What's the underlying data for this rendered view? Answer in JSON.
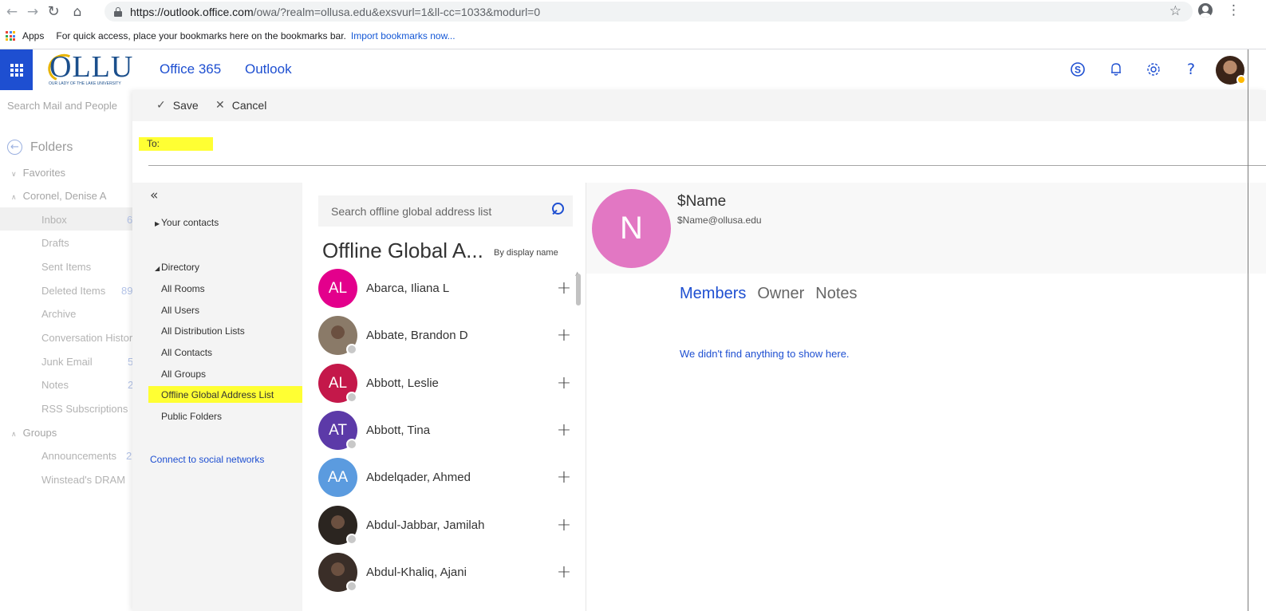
{
  "browser": {
    "url_host": "https://outlook.office.com",
    "url_path": "/owa/?realm=ollusa.edu&exsvurl=1&ll-cc=1033&modurl=0",
    "bookmarks_apps": "Apps",
    "bookmarks_hint": "For quick access, place your bookmarks here on the bookmarks bar.",
    "bookmarks_import": "Import bookmarks now..."
  },
  "header": {
    "logo_text": "OLLU",
    "logo_sub": "OUR LADY OF THE LAKE UNIVERSITY",
    "office365": "Office 365",
    "outlook": "Outlook",
    "icons": [
      "skype-icon",
      "bell-icon",
      "gear-icon",
      "help-icon"
    ]
  },
  "left_nav": {
    "search_placeholder": "Search Mail and People",
    "folders": "Folders",
    "favorites": "Favorites",
    "account": "Coronel, Denise A",
    "items": [
      {
        "label": "Inbox",
        "count": "6"
      },
      {
        "label": "Drafts",
        "count": ""
      },
      {
        "label": "Sent Items",
        "count": ""
      },
      {
        "label": "Deleted Items",
        "count": "89"
      },
      {
        "label": "Archive",
        "count": ""
      },
      {
        "label": "Conversation History",
        "count": ""
      },
      {
        "label": "Junk Email",
        "count": "5"
      },
      {
        "label": "Notes",
        "count": "2"
      },
      {
        "label": "RSS Subscriptions",
        "count": ""
      }
    ],
    "groups": "Groups",
    "group_items": [
      {
        "label": "Announcements",
        "count": "2"
      },
      {
        "label": "Winstead's DRAM",
        "count": ""
      }
    ]
  },
  "compose": {
    "save": "Save",
    "cancel": "Cancel",
    "to_label": "To:"
  },
  "picker_nav": {
    "your_contacts": "Your contacts",
    "directory": "Directory",
    "items": [
      "All Rooms",
      "All Users",
      "All Distribution Lists",
      "All Contacts",
      "All Groups",
      "Offline Global Address List",
      "Public Folders"
    ],
    "connect": "Connect to social networks"
  },
  "gal": {
    "search_placeholder": "Search offline global address list",
    "title": "Offline Global A...",
    "sort": "By display name",
    "contacts": [
      {
        "initials": "AL",
        "name": "Abarca, Iliana L",
        "color": "#e3008c",
        "photo": false,
        "presence": false
      },
      {
        "initials": "",
        "name": "Abbate, Brandon D",
        "color": "#8a7a68",
        "photo": true,
        "presence": true
      },
      {
        "initials": "AL",
        "name": "Abbott, Leslie",
        "color": "#c4184a",
        "photo": false,
        "presence": true
      },
      {
        "initials": "AT",
        "name": "Abbott, Tina",
        "color": "#5c3aa8",
        "photo": false,
        "presence": true
      },
      {
        "initials": "AA",
        "name": "Abdelqader, Ahmed",
        "color": "#5b9bdf",
        "photo": false,
        "presence": false
      },
      {
        "initials": "",
        "name": "Abdul-Jabbar, Jamilah",
        "color": "#2b2520",
        "photo": true,
        "presence": true
      },
      {
        "initials": "",
        "name": "Abdul-Khaliq, Ajani",
        "color": "#3a2e28",
        "photo": true,
        "presence": true
      }
    ]
  },
  "detail": {
    "initial": "N",
    "name": "$Name",
    "email": "$Name@ollusa.edu",
    "tabs": [
      "Members",
      "Owner",
      "Notes"
    ],
    "empty_message": "We didn't find anything to show here."
  },
  "colors": {
    "accent": "#1e4fd1",
    "highlight": "#ffff33",
    "detail_avatar": "#e277c3"
  }
}
